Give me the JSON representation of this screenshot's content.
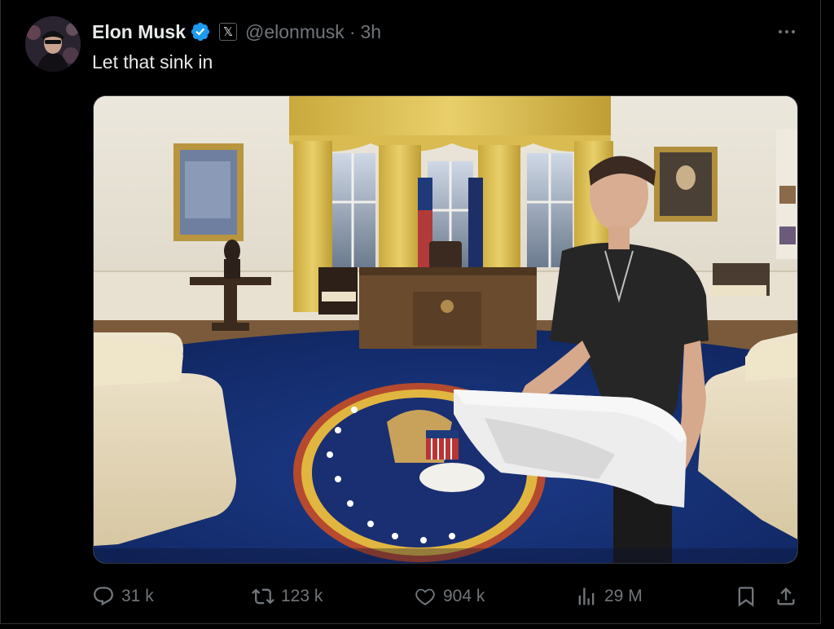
{
  "post": {
    "author": {
      "display_name": "Elon Musk",
      "verified_icon": "verified-badge-icon",
      "affiliation_icon": "x-affiliation-icon",
      "affiliation_glyph": "𝕏",
      "handle": "@elonmusk",
      "separator": "·",
      "time": "3h"
    },
    "text": "Let that sink in",
    "more_icon": "more-horizontal-icon",
    "media": {
      "type": "photo",
      "icon": "photo"
    },
    "actions": {
      "reply": {
        "icon": "reply-icon",
        "count": "31 k"
      },
      "repost": {
        "icon": "repost-icon",
        "count": "123 k"
      },
      "like": {
        "icon": "heart-icon",
        "count": "904 k"
      },
      "views": {
        "icon": "views-chart-icon",
        "count": "29 M"
      },
      "bookmark": {
        "icon": "bookmark-icon"
      },
      "share": {
        "icon": "share-icon"
      }
    }
  },
  "colors": {
    "background": "#000000",
    "primary_text": "#e7e9ea",
    "secondary_text": "#71767b",
    "verified_blue": "#1d9bf0",
    "border": "#2f3336"
  }
}
